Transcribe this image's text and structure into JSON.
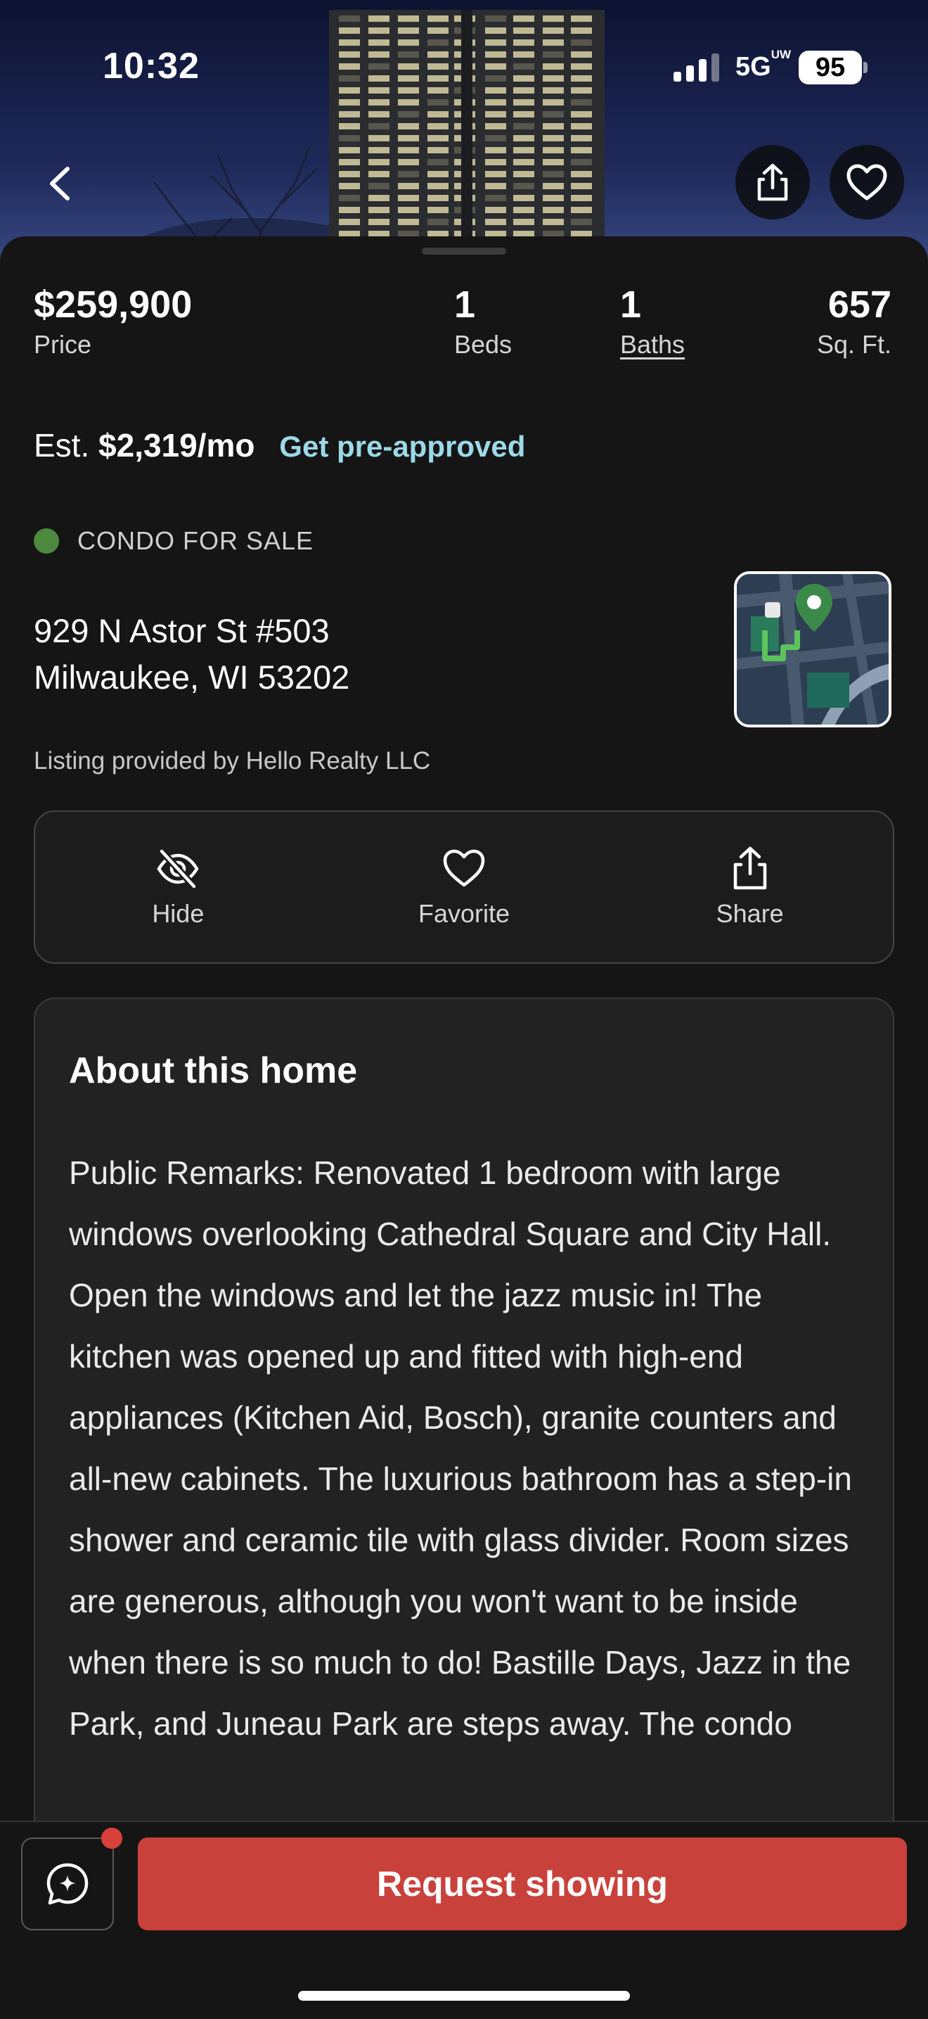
{
  "status_bar": {
    "time": "10:32",
    "network": "5G",
    "network_sup": "UW",
    "battery": "95"
  },
  "hero": {
    "back_icon": "chevron-left-icon",
    "share_icon": "share-icon",
    "favorite_icon": "heart-outline-icon"
  },
  "summary": {
    "price": "$259,900",
    "price_label": "Price",
    "beds": "1",
    "beds_label": "Beds",
    "baths": "1",
    "baths_label": "Baths",
    "sqft": "657",
    "sqft_label": "Sq. Ft."
  },
  "estimate": {
    "prefix": "Est.",
    "amount": "$2,319/mo",
    "link": "Get pre-approved"
  },
  "listing_status": {
    "text": "CONDO FOR SALE",
    "color": "#4c8a3f"
  },
  "address": {
    "line1": "929 N Astor St #503",
    "line2": "Milwaukee, WI 53202"
  },
  "provided_by": "Listing provided by Hello Realty LLC",
  "actions": [
    {
      "label": "Hide",
      "icon": "eye-off-icon"
    },
    {
      "label": "Favorite",
      "icon": "heart-outline-icon"
    },
    {
      "label": "Share",
      "icon": "share-icon"
    }
  ],
  "about": {
    "title": "About this home",
    "body": "Public Remarks: Renovated 1 bedroom with large windows overlooking Cathedral Square and City Hall. Open the windows and let the jazz music in! The kitchen was opened up and fitted with high-end appliances (Kitchen Aid, Bosch), granite counters and all-new cabinets. The luxurious bathroom has a step-in shower and ceramic tile with glass divider. Room sizes are generous, although you won't want to be inside when there is so much to do! Bastille Days, Jazz in the Park, and Juneau Park are steps away. The condo"
  },
  "bottom_bar": {
    "chat_icon": "chat-sparkle-icon",
    "request_label": "Request showing"
  },
  "colors": {
    "accent": "#c9413b",
    "link": "#9cd9e8",
    "background": "#151515"
  }
}
